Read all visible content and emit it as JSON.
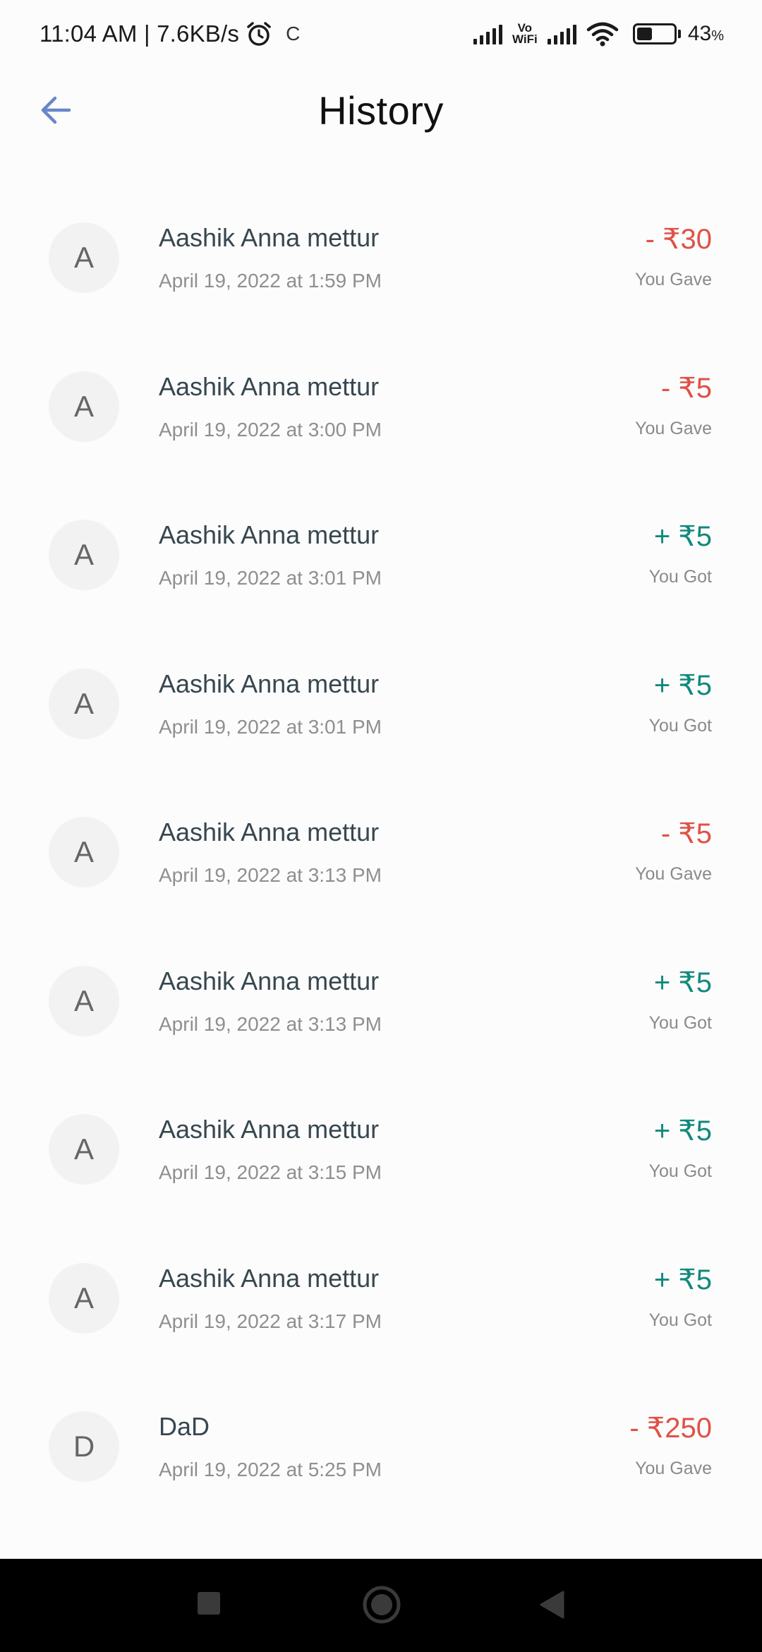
{
  "status_bar": {
    "time_speed": "11:04 AM | 7.6KB/s",
    "sync_glyph": "C",
    "vowifi_top": "Vo",
    "vowifi_bottom": "WiFi",
    "battery_percent": "43",
    "battery_unit": "%",
    "battery_level": 0.43
  },
  "header": {
    "title": "History",
    "back_icon": "arrow-left-icon",
    "accent_color": "#6a86c9"
  },
  "colors": {
    "gave": "#e05047",
    "got": "#11897c"
  },
  "transactions": [
    {
      "avatar": "A",
      "name": "Aashik Anna mettur",
      "date": "April 19, 2022 at 1:59 PM",
      "amount": "- ₹30",
      "kind": "You Gave",
      "type": "gave"
    },
    {
      "avatar": "A",
      "name": "Aashik Anna mettur",
      "date": "April 19, 2022 at 3:00 PM",
      "amount": "- ₹5",
      "kind": "You Gave",
      "type": "gave"
    },
    {
      "avatar": "A",
      "name": "Aashik Anna mettur",
      "date": "April 19, 2022 at 3:01 PM",
      "amount": "+ ₹5",
      "kind": "You Got",
      "type": "got"
    },
    {
      "avatar": "A",
      "name": "Aashik Anna mettur",
      "date": "April 19, 2022 at 3:01 PM",
      "amount": "+ ₹5",
      "kind": "You Got",
      "type": "got"
    },
    {
      "avatar": "A",
      "name": "Aashik Anna mettur",
      "date": "April 19, 2022 at 3:13 PM",
      "amount": "- ₹5",
      "kind": "You Gave",
      "type": "gave"
    },
    {
      "avatar": "A",
      "name": "Aashik Anna mettur",
      "date": "April 19, 2022 at 3:13 PM",
      "amount": "+ ₹5",
      "kind": "You Got",
      "type": "got"
    },
    {
      "avatar": "A",
      "name": "Aashik Anna mettur",
      "date": "April 19, 2022 at 3:15 PM",
      "amount": "+ ₹5",
      "kind": "You Got",
      "type": "got"
    },
    {
      "avatar": "A",
      "name": "Aashik Anna mettur",
      "date": "April 19, 2022 at 3:17 PM",
      "amount": "+ ₹5",
      "kind": "You Got",
      "type": "got"
    },
    {
      "avatar": "D",
      "name": "DaD",
      "date": "April 19, 2022 at 5:25 PM",
      "amount": "- ₹250",
      "kind": "You Gave",
      "type": "gave"
    }
  ],
  "nav_bar": {
    "recent_icon": "square-recent-apps-icon",
    "home_icon": "circle-home-icon",
    "back_icon": "triangle-back-icon"
  }
}
